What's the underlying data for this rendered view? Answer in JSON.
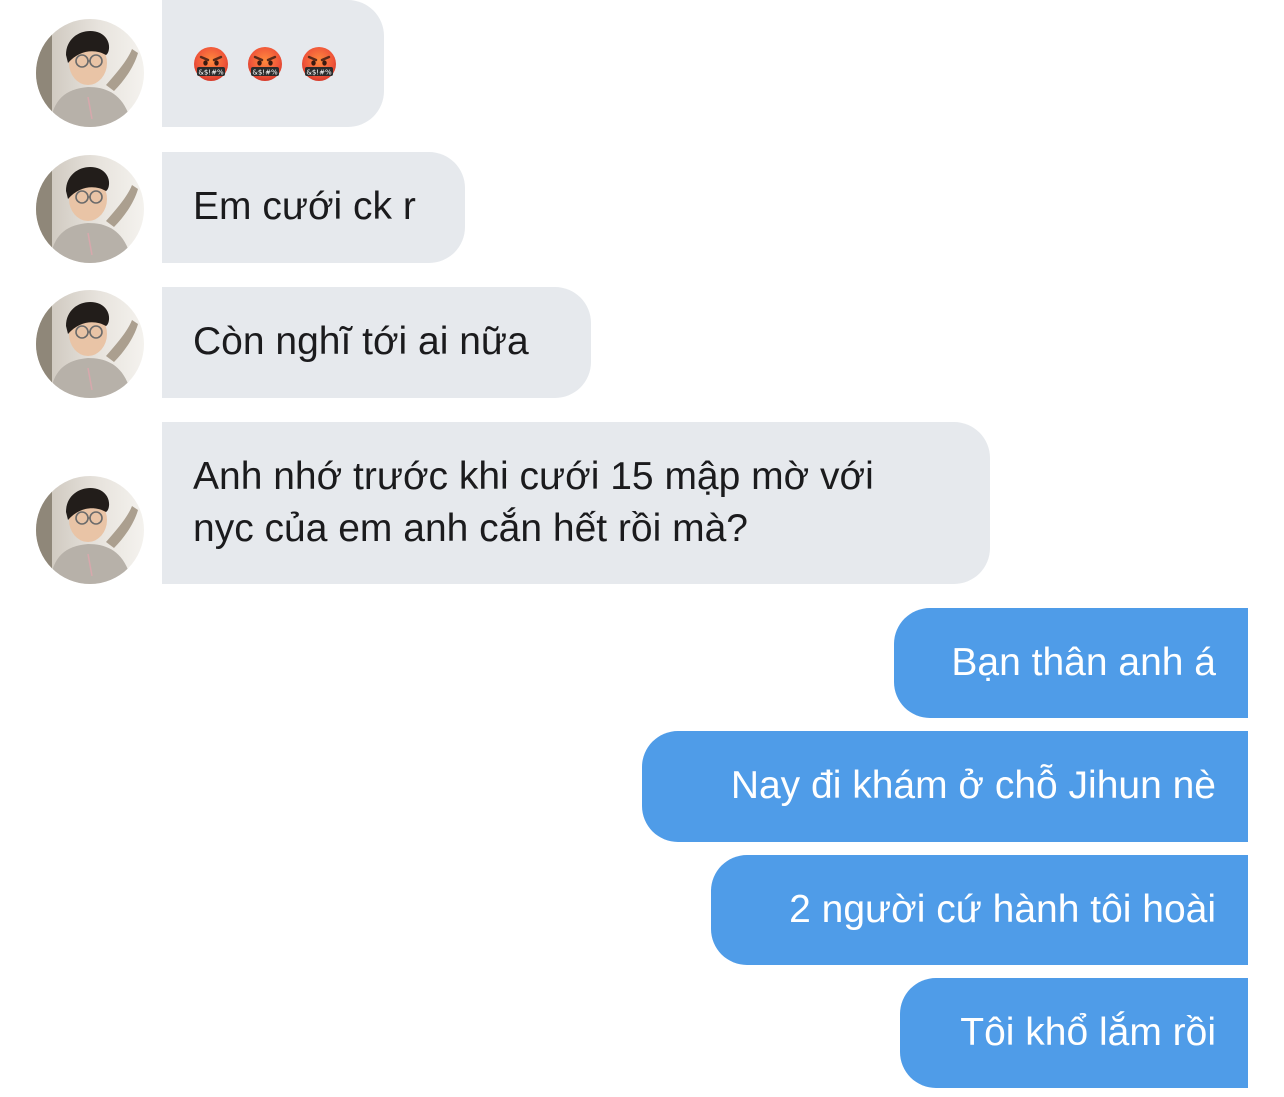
{
  "conversation": {
    "incoming": [
      {
        "type": "emoji",
        "emojis": [
          "face-with-symbols-on-mouth",
          "face-with-symbols-on-mouth",
          "face-with-symbols-on-mouth"
        ],
        "emoji_text": "&$!#%"
      },
      {
        "type": "text",
        "lines": [
          "Em cưới ck r"
        ]
      },
      {
        "type": "text",
        "lines": [
          "Còn nghĩ tới ai nữa"
        ]
      },
      {
        "type": "text",
        "lines": [
          "Anh nhớ trước khi cưới 15 mập mờ với",
          "nyc của em anh cắn hết rồi mà?"
        ]
      }
    ],
    "outgoing": [
      {
        "lines": [
          "Bạn thân anh á"
        ]
      },
      {
        "lines": [
          "Nay đi khám ở chỗ Jihun nè"
        ]
      },
      {
        "lines": [
          "2 người cứ hành tôi hoài"
        ]
      },
      {
        "lines": [
          "Tôi khổ lắm rồi"
        ]
      }
    ]
  },
  "colors": {
    "incoming_bubble": "#e6e9ed",
    "incoming_text": "#1b1b1d",
    "outgoing_bubble": "#4f9ce8",
    "outgoing_text": "#ffffff"
  },
  "icons": {
    "avatar": "avatar-photo-icon",
    "emoji": "face-with-symbols-icon"
  }
}
